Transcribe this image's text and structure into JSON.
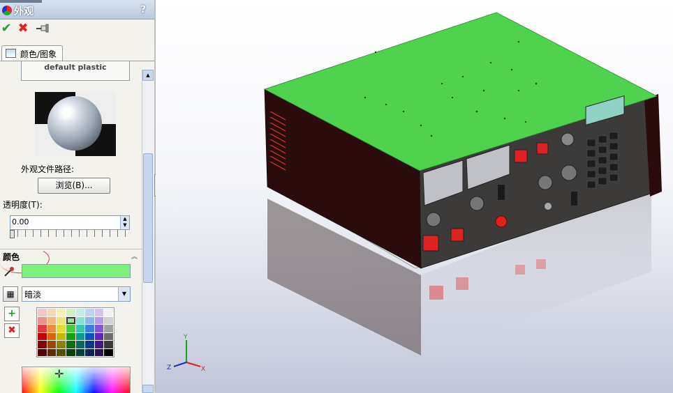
{
  "panel": {
    "title": "外观",
    "help": "?",
    "toolbar": {
      "ok": "✔",
      "cancel": "✖",
      "pin": "📌"
    },
    "tab_label": "颜色/图象",
    "appearance_name": "default plastic",
    "path_label": "外观文件路径:",
    "browse_label": "浏览(B)...",
    "transparency_label": "透明度(T):",
    "transparency_value": "0.00",
    "transparency_fraction": 0,
    "color_section_title": "颜色",
    "current_color": "#7ef07e",
    "palette_value": "暗淡",
    "add_symbol": "+",
    "remove_symbol": "✖"
  },
  "icons": [
    "appearance-icon",
    "help-icon",
    "ok-icon",
    "cancel-icon",
    "pin-icon",
    "tab-image-icon",
    "chevron-up-icon",
    "eyedropper-icon",
    "palette-icon",
    "add-color-icon",
    "remove-color-icon",
    "crosshair-icon",
    "splitter-arrow-icon",
    "axis-triad"
  ],
  "palette_colors": [
    "#f4c6c6",
    "#f6d7b4",
    "#f7f1b0",
    "#cdf1bf",
    "#bfeee4",
    "#bed3f1",
    "#d4c3ef",
    "#f2f2f2",
    "#ee8f8f",
    "#f2b780",
    "#eee57a",
    "#97e58a",
    "#8ae0d0",
    "#8fb4ec",
    "#b59ce6",
    "#d0d0d0",
    "#e23c3c",
    "#ef8c3a",
    "#e6d93a",
    "#42cf3a",
    "#38c4b0",
    "#3b7ee3",
    "#8256db",
    "#a2a2a2",
    "#c40000",
    "#d96600",
    "#c7b800",
    "#10a010",
    "#0a9a8a",
    "#0c50c6",
    "#6024c0",
    "#6e6e6e",
    "#8a0000",
    "#9b4700",
    "#8c8100",
    "#0a6e0a",
    "#066a5f",
    "#083a8c",
    "#43198a",
    "#3a3a3a",
    "#520000",
    "#5e2b00",
    "#555000",
    "#064306",
    "#03403a",
    "#052457",
    "#290f54",
    "#000000"
  ],
  "selected_palette_index": 11,
  "triad_labels": {
    "x": "X",
    "y": "Y",
    "z": "Z"
  },
  "colors": {
    "model_top": "#4fd34f",
    "model_body": "#2b0c0c",
    "front_panel": "#3d3b39",
    "panel_bg": "#f3f2ec"
  }
}
